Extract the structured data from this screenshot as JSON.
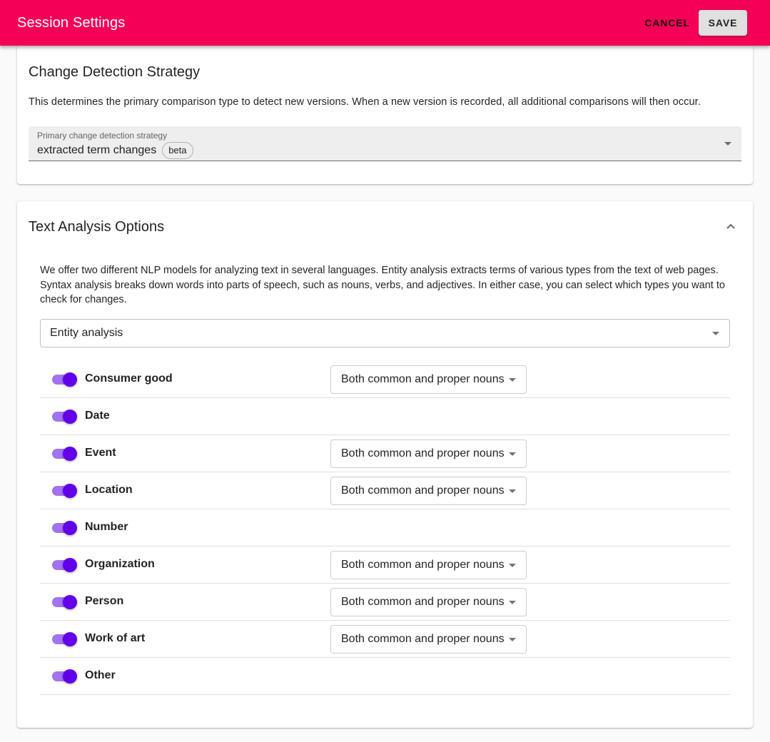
{
  "appbar": {
    "title": "Session Settings",
    "cancel_label": "CANCEL",
    "save_label": "SAVE",
    "color": "#f50057"
  },
  "change_detection": {
    "title": "Change Detection Strategy",
    "description": "This determines the primary comparison type to detect new versions. When a new version is recorded, all additional comparisons will then occur.",
    "select_label": "Primary change detection strategy",
    "select_value": "extracted term changes",
    "badge": "beta"
  },
  "text_analysis": {
    "title": "Text Analysis Options",
    "description": "We offer two different NLP models for analyzing text in several languages. Entity analysis extracts terms of various types from the text of web pages. Syntax analysis breaks down words into parts of speech, such as nouns, verbs, and adjectives. In either case, you can select which types you want to check for changes.",
    "model_value": "Entity analysis",
    "toggle_color": "#6200ea",
    "entities": [
      {
        "label": "Consumer good",
        "enabled": true,
        "noun_option": "Both common and proper nouns"
      },
      {
        "label": "Date",
        "enabled": true,
        "noun_option": null
      },
      {
        "label": "Event",
        "enabled": true,
        "noun_option": "Both common and proper nouns"
      },
      {
        "label": "Location",
        "enabled": true,
        "noun_option": "Both common and proper nouns"
      },
      {
        "label": "Number",
        "enabled": true,
        "noun_option": null
      },
      {
        "label": "Organization",
        "enabled": true,
        "noun_option": "Both common and proper nouns"
      },
      {
        "label": "Person",
        "enabled": true,
        "noun_option": "Both common and proper nouns"
      },
      {
        "label": "Work of art",
        "enabled": true,
        "noun_option": "Both common and proper nouns"
      },
      {
        "label": "Other",
        "enabled": true,
        "noun_option": null
      }
    ]
  }
}
